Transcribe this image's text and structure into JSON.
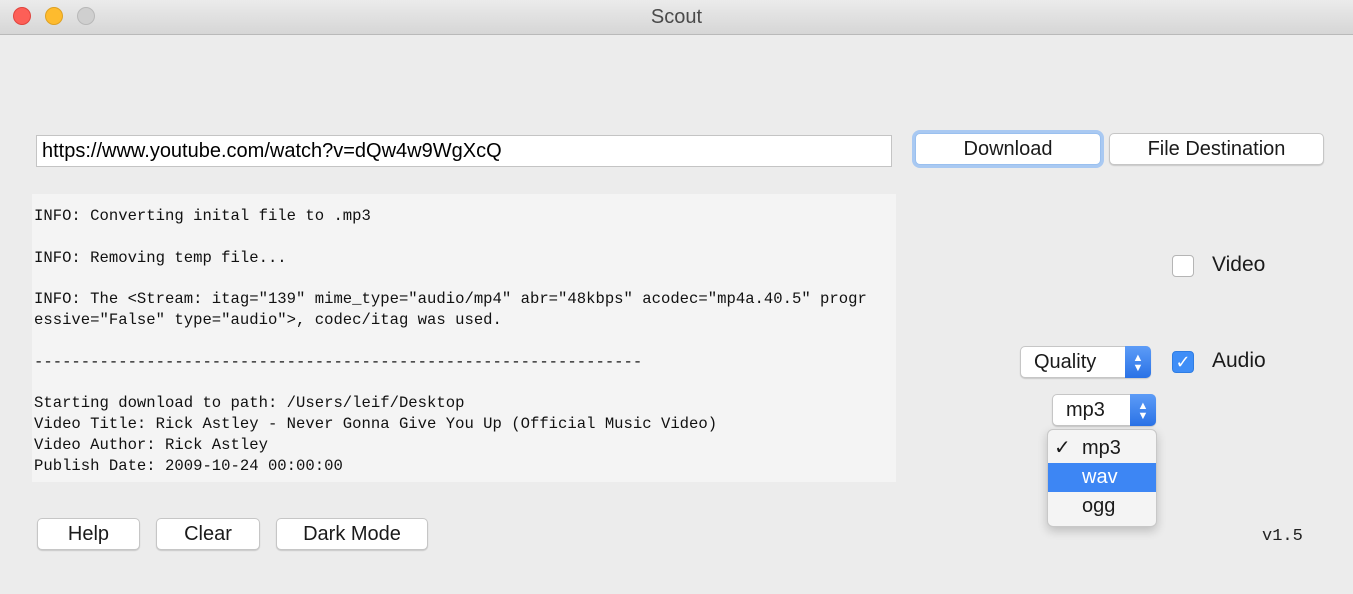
{
  "window": {
    "title": "Scout"
  },
  "url_input": {
    "value": "https://www.youtube.com/watch?v=dQw4w9WgXcQ"
  },
  "buttons": {
    "download": "Download",
    "file_destination": "File Destination",
    "help": "Help",
    "clear": "Clear",
    "dark_mode": "Dark Mode"
  },
  "log": {
    "lines": [
      "INFO: Converting inital file to .mp3",
      "",
      "INFO: Removing temp file...",
      "",
      "INFO: The <Stream: itag=\"139\" mime_type=\"audio/mp4\" abr=\"48kbps\" acodec=\"mp4a.40.5\" progr",
      "essive=\"False\" type=\"audio\">, codec/itag was used.",
      "",
      "-----------------------------------------------------------------",
      "",
      "Starting download to path: /Users/leif/Desktop",
      "Video Title: Rick Astley - Never Gonna Give You Up (Official Music Video)",
      "Video Author: Rick Astley",
      "Publish Date: 2009-10-24 00:00:00"
    ]
  },
  "options": {
    "video": {
      "label": "Video",
      "checked": false
    },
    "audio": {
      "label": "Audio",
      "checked": true
    },
    "quality": {
      "selected": "Quality"
    },
    "format": {
      "selected": "mp3",
      "menu_items": [
        "mp3",
        "wav",
        "ogg"
      ],
      "highlighted": "wav",
      "check_glyph": "✓"
    }
  },
  "version": "v1.5",
  "colors": {
    "accent": "#3d86f4",
    "close": "#fd5f57",
    "minimize": "#febb2e"
  }
}
